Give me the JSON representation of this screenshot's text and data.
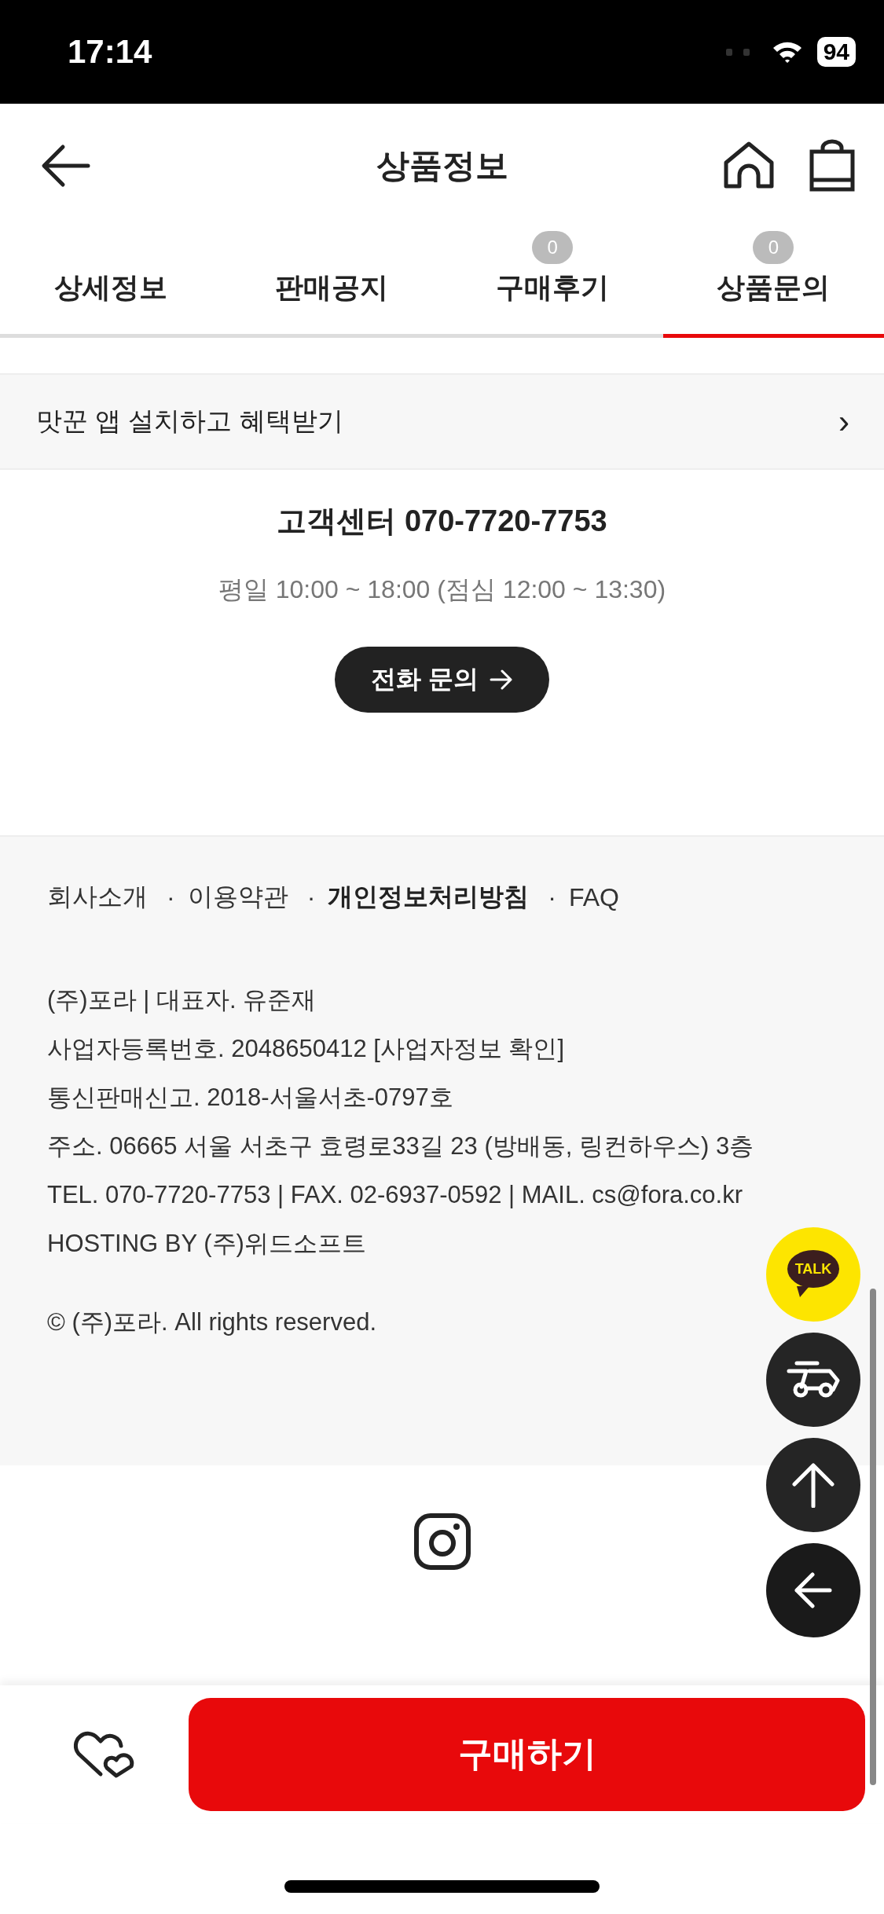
{
  "status_bar": {
    "time": "17:14",
    "battery": "94"
  },
  "header": {
    "title": "상품정보"
  },
  "tabs": [
    {
      "label": "상세정보",
      "selected": false
    },
    {
      "label": "판매공지",
      "selected": false
    },
    {
      "label": "구매후기",
      "count": "0",
      "selected": false
    },
    {
      "label": "상품문의",
      "count": "0",
      "selected": true
    }
  ],
  "app_banner": {
    "text": "맛꾼 앱 설치하고 혜택받기",
    "chevron": "›"
  },
  "customer_center": {
    "title": "고객센터 070-7720-7753",
    "hours": "평일 10:00 ~ 18:00 (점심 12:00 ~ 13:30)",
    "button": "전화 문의"
  },
  "footer": {
    "links": [
      {
        "label": "회사소개",
        "bold": false
      },
      {
        "prefix": "·",
        "label": "이용약관",
        "bold": false
      },
      {
        "prefix": "·",
        "label": "개인정보처리방침",
        "bold": true
      },
      {
        "prefix": "·",
        "label": "FAQ",
        "bold": false
      }
    ],
    "info_lines": [
      "(주)포라 | 대표자. 유준재",
      "사업자등록번호. 2048650412 [사업자정보 확인]",
      "통신판매신고. 2018-서울서초-0797호",
      "주소. 06665 서울 서초구 효령로33길 23 (방배동, 링컨하우스) 3층",
      "TEL. 070-7720-7753 | FAX. 02-6937-0592 | MAIL. cs@fora.co.kr",
      "HOSTING BY (주)위드소프트"
    ],
    "copyright": "© (주)포라. All rights reserved."
  },
  "floating_buttons": [
    {
      "kind": "talk",
      "label": "TALK"
    },
    {
      "kind": "delivery"
    },
    {
      "kind": "top"
    },
    {
      "kind": "back"
    }
  ],
  "bottom_bar": {
    "buy_button": "구매하기"
  }
}
